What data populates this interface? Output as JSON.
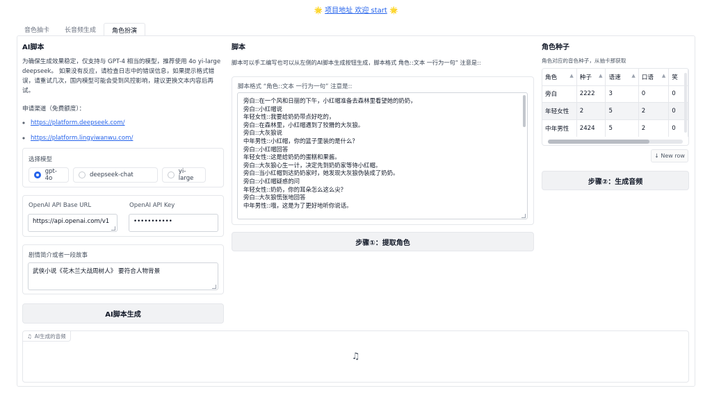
{
  "header": {
    "left_emoji": "🌟",
    "link_text": "项目地址 欢迎 start",
    "right_emoji": "🌟"
  },
  "tabs": [
    {
      "label": "音色抽卡",
      "active": false
    },
    {
      "label": "长音频生成",
      "active": false
    },
    {
      "label": "角色扮演",
      "active": true
    }
  ],
  "ai_script": {
    "title": "AI脚本",
    "description": "为确保生成效果稳定，仅支持与 GPT-4 相当的模型，推荐使用 4o yi-large deepseek。 如果没有反应，请检查日志中的错误信息，如果提示格式错误，请重试几次，国内模型可能会受到风控影响，建议更换文本内容后再试。",
    "apply_label": "申请渠道（免费额度）：",
    "links": [
      "https://platform.deepseek.com/",
      "https://platform.lingyiwanwu.com/"
    ],
    "model_label": "选择模型",
    "models": [
      {
        "label": "gpt-4o",
        "selected": true
      },
      {
        "label": "deepseek-chat",
        "selected": false
      },
      {
        "label": "yi-large",
        "selected": false
      }
    ],
    "base_url_label": "OpenAI API Base URL",
    "base_url_value": "https://api.openai.com/v1",
    "api_key_label": "OpenAI API Key",
    "api_key_value": "•••••••••••",
    "story_label": "剧情简介或者一段故事",
    "story_value": "武侠小说《花木兰大战周树人》 要符合人物背景",
    "generate_button": "AI脚本生成"
  },
  "script": {
    "title": "脚本",
    "description": "脚本可以手工编写也可以从左侧的AI脚本生成按钮生成，脚本格式 角色::文本 一行为一句” 注意是::",
    "area_label": "脚本格式 “角色::文本 一行为一句” 注意是::",
    "lines": [
      "旁白::在一个风和日丽的下午，小红帽准备去森林里看望她的奶奶，",
      "旁白::小红帽说",
      "年轻女性::我要给奶奶带点好吃的，",
      "旁白::在森林里，小红帽遇到了狡猾的大灰狼。",
      "旁白::大灰狼说",
      "中年男性::小红帽，你的篮子里装的是什么？",
      "旁白::小红帽回答",
      "年轻女性::这是给奶奶的蛋糕和果酱。",
      "旁白::大灰狼心生一计，决定先到奶奶家等待小红帽。",
      "旁白::当小红帽到达奶奶家时，她发现大灰狼伪装成了奶奶。",
      "旁白::小红帽疑惑的问",
      "年轻女性::奶奶，你的耳朵怎么这么尖？",
      "旁白::大灰狼慌张地回答",
      "中年男性::哦，这是为了更好地听你说话。"
    ],
    "extract_button": "步骤①：提取角色"
  },
  "seeds": {
    "title": "角色种子",
    "description": "角色对应的音色种子，从抽卡那获取",
    "columns": [
      "角色",
      "种子",
      "语速",
      "口语",
      "笑"
    ],
    "rows": [
      [
        "旁白",
        "2222",
        "3",
        "0",
        "0"
      ],
      [
        "年轻女性",
        "2",
        "5",
        "2",
        "0"
      ],
      [
        "中年男性",
        "2424",
        "5",
        "2",
        "0"
      ]
    ],
    "new_row_button": "↓ New row",
    "generate_audio_button": "步骤②：生成音频"
  },
  "audio": {
    "label": "AI生成的音频",
    "icon": "music-note-icon"
  }
}
